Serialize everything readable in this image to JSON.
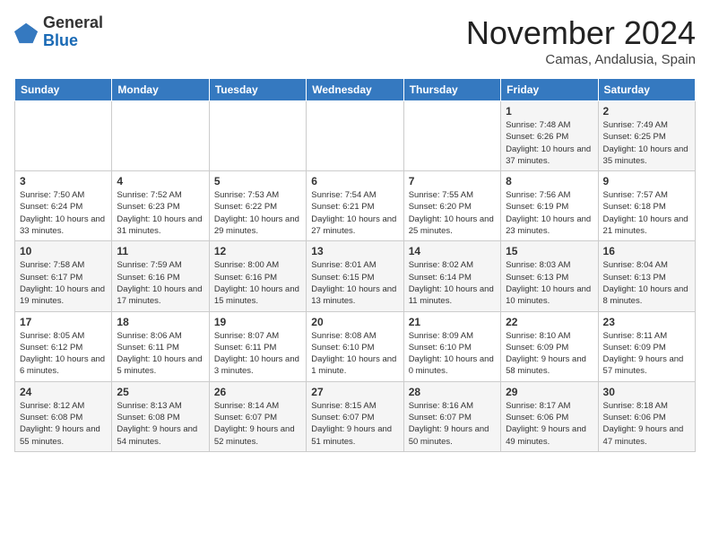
{
  "header": {
    "logo_general": "General",
    "logo_blue": "Blue",
    "month_title": "November 2024",
    "location": "Camas, Andalusia, Spain"
  },
  "days_of_week": [
    "Sunday",
    "Monday",
    "Tuesday",
    "Wednesday",
    "Thursday",
    "Friday",
    "Saturday"
  ],
  "weeks": [
    [
      {
        "day": "",
        "info": ""
      },
      {
        "day": "",
        "info": ""
      },
      {
        "day": "",
        "info": ""
      },
      {
        "day": "",
        "info": ""
      },
      {
        "day": "",
        "info": ""
      },
      {
        "day": "1",
        "info": "Sunrise: 7:48 AM\nSunset: 6:26 PM\nDaylight: 10 hours and 37 minutes."
      },
      {
        "day": "2",
        "info": "Sunrise: 7:49 AM\nSunset: 6:25 PM\nDaylight: 10 hours and 35 minutes."
      }
    ],
    [
      {
        "day": "3",
        "info": "Sunrise: 7:50 AM\nSunset: 6:24 PM\nDaylight: 10 hours and 33 minutes."
      },
      {
        "day": "4",
        "info": "Sunrise: 7:52 AM\nSunset: 6:23 PM\nDaylight: 10 hours and 31 minutes."
      },
      {
        "day": "5",
        "info": "Sunrise: 7:53 AM\nSunset: 6:22 PM\nDaylight: 10 hours and 29 minutes."
      },
      {
        "day": "6",
        "info": "Sunrise: 7:54 AM\nSunset: 6:21 PM\nDaylight: 10 hours and 27 minutes."
      },
      {
        "day": "7",
        "info": "Sunrise: 7:55 AM\nSunset: 6:20 PM\nDaylight: 10 hours and 25 minutes."
      },
      {
        "day": "8",
        "info": "Sunrise: 7:56 AM\nSunset: 6:19 PM\nDaylight: 10 hours and 23 minutes."
      },
      {
        "day": "9",
        "info": "Sunrise: 7:57 AM\nSunset: 6:18 PM\nDaylight: 10 hours and 21 minutes."
      }
    ],
    [
      {
        "day": "10",
        "info": "Sunrise: 7:58 AM\nSunset: 6:17 PM\nDaylight: 10 hours and 19 minutes."
      },
      {
        "day": "11",
        "info": "Sunrise: 7:59 AM\nSunset: 6:16 PM\nDaylight: 10 hours and 17 minutes."
      },
      {
        "day": "12",
        "info": "Sunrise: 8:00 AM\nSunset: 6:16 PM\nDaylight: 10 hours and 15 minutes."
      },
      {
        "day": "13",
        "info": "Sunrise: 8:01 AM\nSunset: 6:15 PM\nDaylight: 10 hours and 13 minutes."
      },
      {
        "day": "14",
        "info": "Sunrise: 8:02 AM\nSunset: 6:14 PM\nDaylight: 10 hours and 11 minutes."
      },
      {
        "day": "15",
        "info": "Sunrise: 8:03 AM\nSunset: 6:13 PM\nDaylight: 10 hours and 10 minutes."
      },
      {
        "day": "16",
        "info": "Sunrise: 8:04 AM\nSunset: 6:13 PM\nDaylight: 10 hours and 8 minutes."
      }
    ],
    [
      {
        "day": "17",
        "info": "Sunrise: 8:05 AM\nSunset: 6:12 PM\nDaylight: 10 hours and 6 minutes."
      },
      {
        "day": "18",
        "info": "Sunrise: 8:06 AM\nSunset: 6:11 PM\nDaylight: 10 hours and 5 minutes."
      },
      {
        "day": "19",
        "info": "Sunrise: 8:07 AM\nSunset: 6:11 PM\nDaylight: 10 hours and 3 minutes."
      },
      {
        "day": "20",
        "info": "Sunrise: 8:08 AM\nSunset: 6:10 PM\nDaylight: 10 hours and 1 minute."
      },
      {
        "day": "21",
        "info": "Sunrise: 8:09 AM\nSunset: 6:10 PM\nDaylight: 10 hours and 0 minutes."
      },
      {
        "day": "22",
        "info": "Sunrise: 8:10 AM\nSunset: 6:09 PM\nDaylight: 9 hours and 58 minutes."
      },
      {
        "day": "23",
        "info": "Sunrise: 8:11 AM\nSunset: 6:09 PM\nDaylight: 9 hours and 57 minutes."
      }
    ],
    [
      {
        "day": "24",
        "info": "Sunrise: 8:12 AM\nSunset: 6:08 PM\nDaylight: 9 hours and 55 minutes."
      },
      {
        "day": "25",
        "info": "Sunrise: 8:13 AM\nSunset: 6:08 PM\nDaylight: 9 hours and 54 minutes."
      },
      {
        "day": "26",
        "info": "Sunrise: 8:14 AM\nSunset: 6:07 PM\nDaylight: 9 hours and 52 minutes."
      },
      {
        "day": "27",
        "info": "Sunrise: 8:15 AM\nSunset: 6:07 PM\nDaylight: 9 hours and 51 minutes."
      },
      {
        "day": "28",
        "info": "Sunrise: 8:16 AM\nSunset: 6:07 PM\nDaylight: 9 hours and 50 minutes."
      },
      {
        "day": "29",
        "info": "Sunrise: 8:17 AM\nSunset: 6:06 PM\nDaylight: 9 hours and 49 minutes."
      },
      {
        "day": "30",
        "info": "Sunrise: 8:18 AM\nSunset: 6:06 PM\nDaylight: 9 hours and 47 minutes."
      }
    ]
  ]
}
